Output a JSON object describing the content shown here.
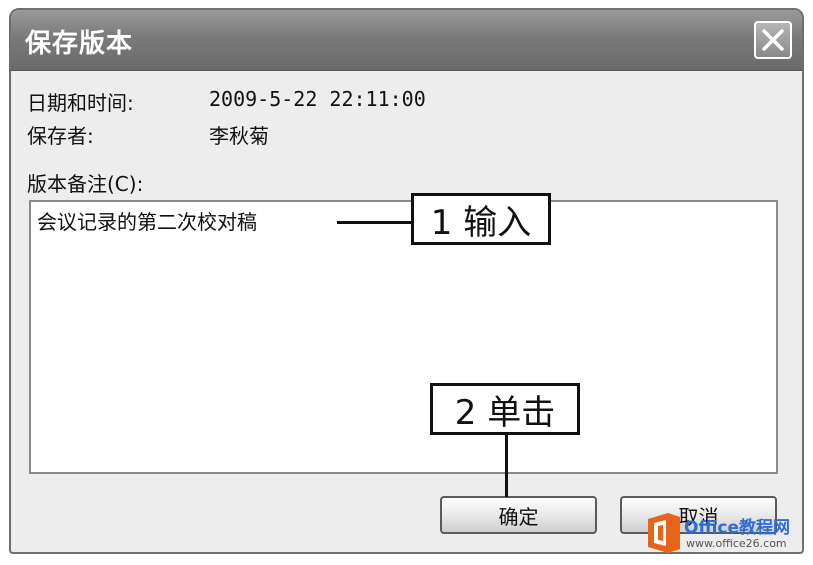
{
  "window": {
    "title": "保存版本"
  },
  "info": {
    "datetime_label": "日期和时间:",
    "datetime_value": "2009-5-22  22:11:00",
    "saver_label": "保存者:",
    "saver_value": "李秋菊"
  },
  "notes": {
    "label": "版本备注(C):",
    "value": "会议记录的第二次校对稿"
  },
  "callouts": {
    "step1": "1 输入",
    "step2": "2 单击"
  },
  "buttons": {
    "ok_label": "确定",
    "cancel_label": "取消"
  },
  "watermark": {
    "title": "Office教程网",
    "url": "www.office26.com"
  },
  "colors": {
    "titlebar": "#7a7a7a",
    "dialog_bg": "#ededed",
    "watermark_orange": "#e8641b",
    "watermark_blue": "#2e6dd6"
  }
}
